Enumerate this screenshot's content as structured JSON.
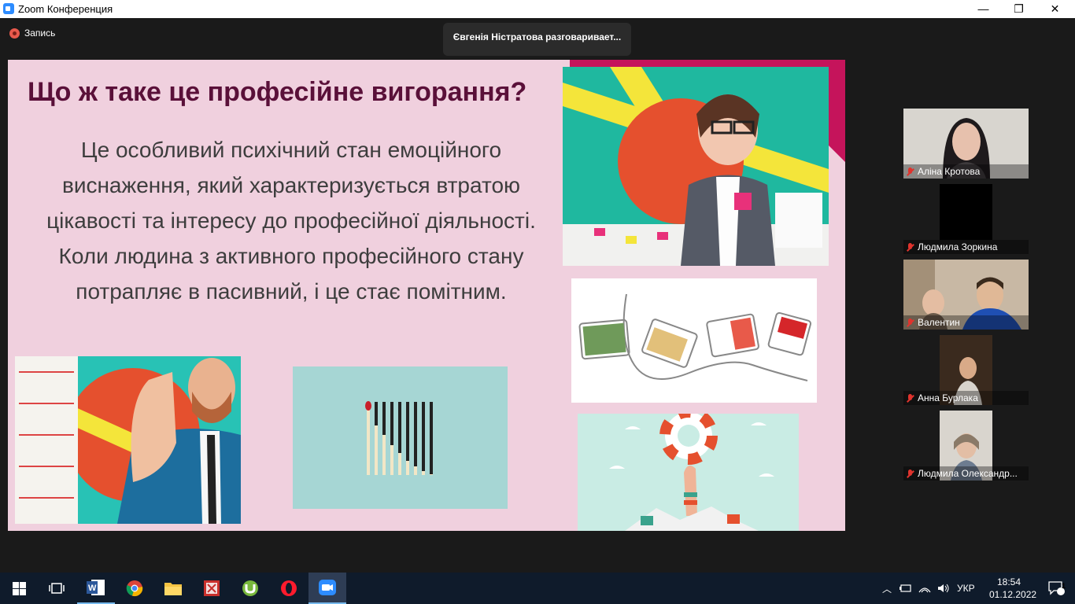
{
  "window": {
    "title": "Zoom Конференция",
    "minimize": "—",
    "restore": "❐",
    "close": "✕"
  },
  "meeting": {
    "recording_label": "Запись",
    "active_speaker": "Євгенія Ністратова разговаривает..."
  },
  "slide": {
    "title": "Що ж таке це професійне вигорання?",
    "body": "Це особливий психічний стан емоційного виснаження, який характеризується втратою цікавості та інтересу до професійної діяльності. Коли людина з активного професійного стану потрапляє в пасивний, і це стає помітним."
  },
  "participants": [
    {
      "name": "Аліна Кротова",
      "muted": true
    },
    {
      "name": "Людмила Зоркина",
      "muted": true
    },
    {
      "name": "Валентин",
      "muted": true
    },
    {
      "name": "Анна Бурлака",
      "muted": true
    },
    {
      "name": "Людмила Олександр...",
      "muted": true
    }
  ],
  "taskbar": {
    "apps": [
      "windows-start",
      "task-view",
      "word",
      "chrome",
      "file-explorer",
      "pdf-reader",
      "utorrent",
      "opera",
      "zoom"
    ],
    "language": "УКР",
    "time": "18:54",
    "date": "01.12.2022",
    "notification_count": "1"
  },
  "colors": {
    "slide_bg": "#f0d0de",
    "title_color": "#5a1039",
    "accent": "#c5145b",
    "taskbar": "#0f1b2b"
  }
}
